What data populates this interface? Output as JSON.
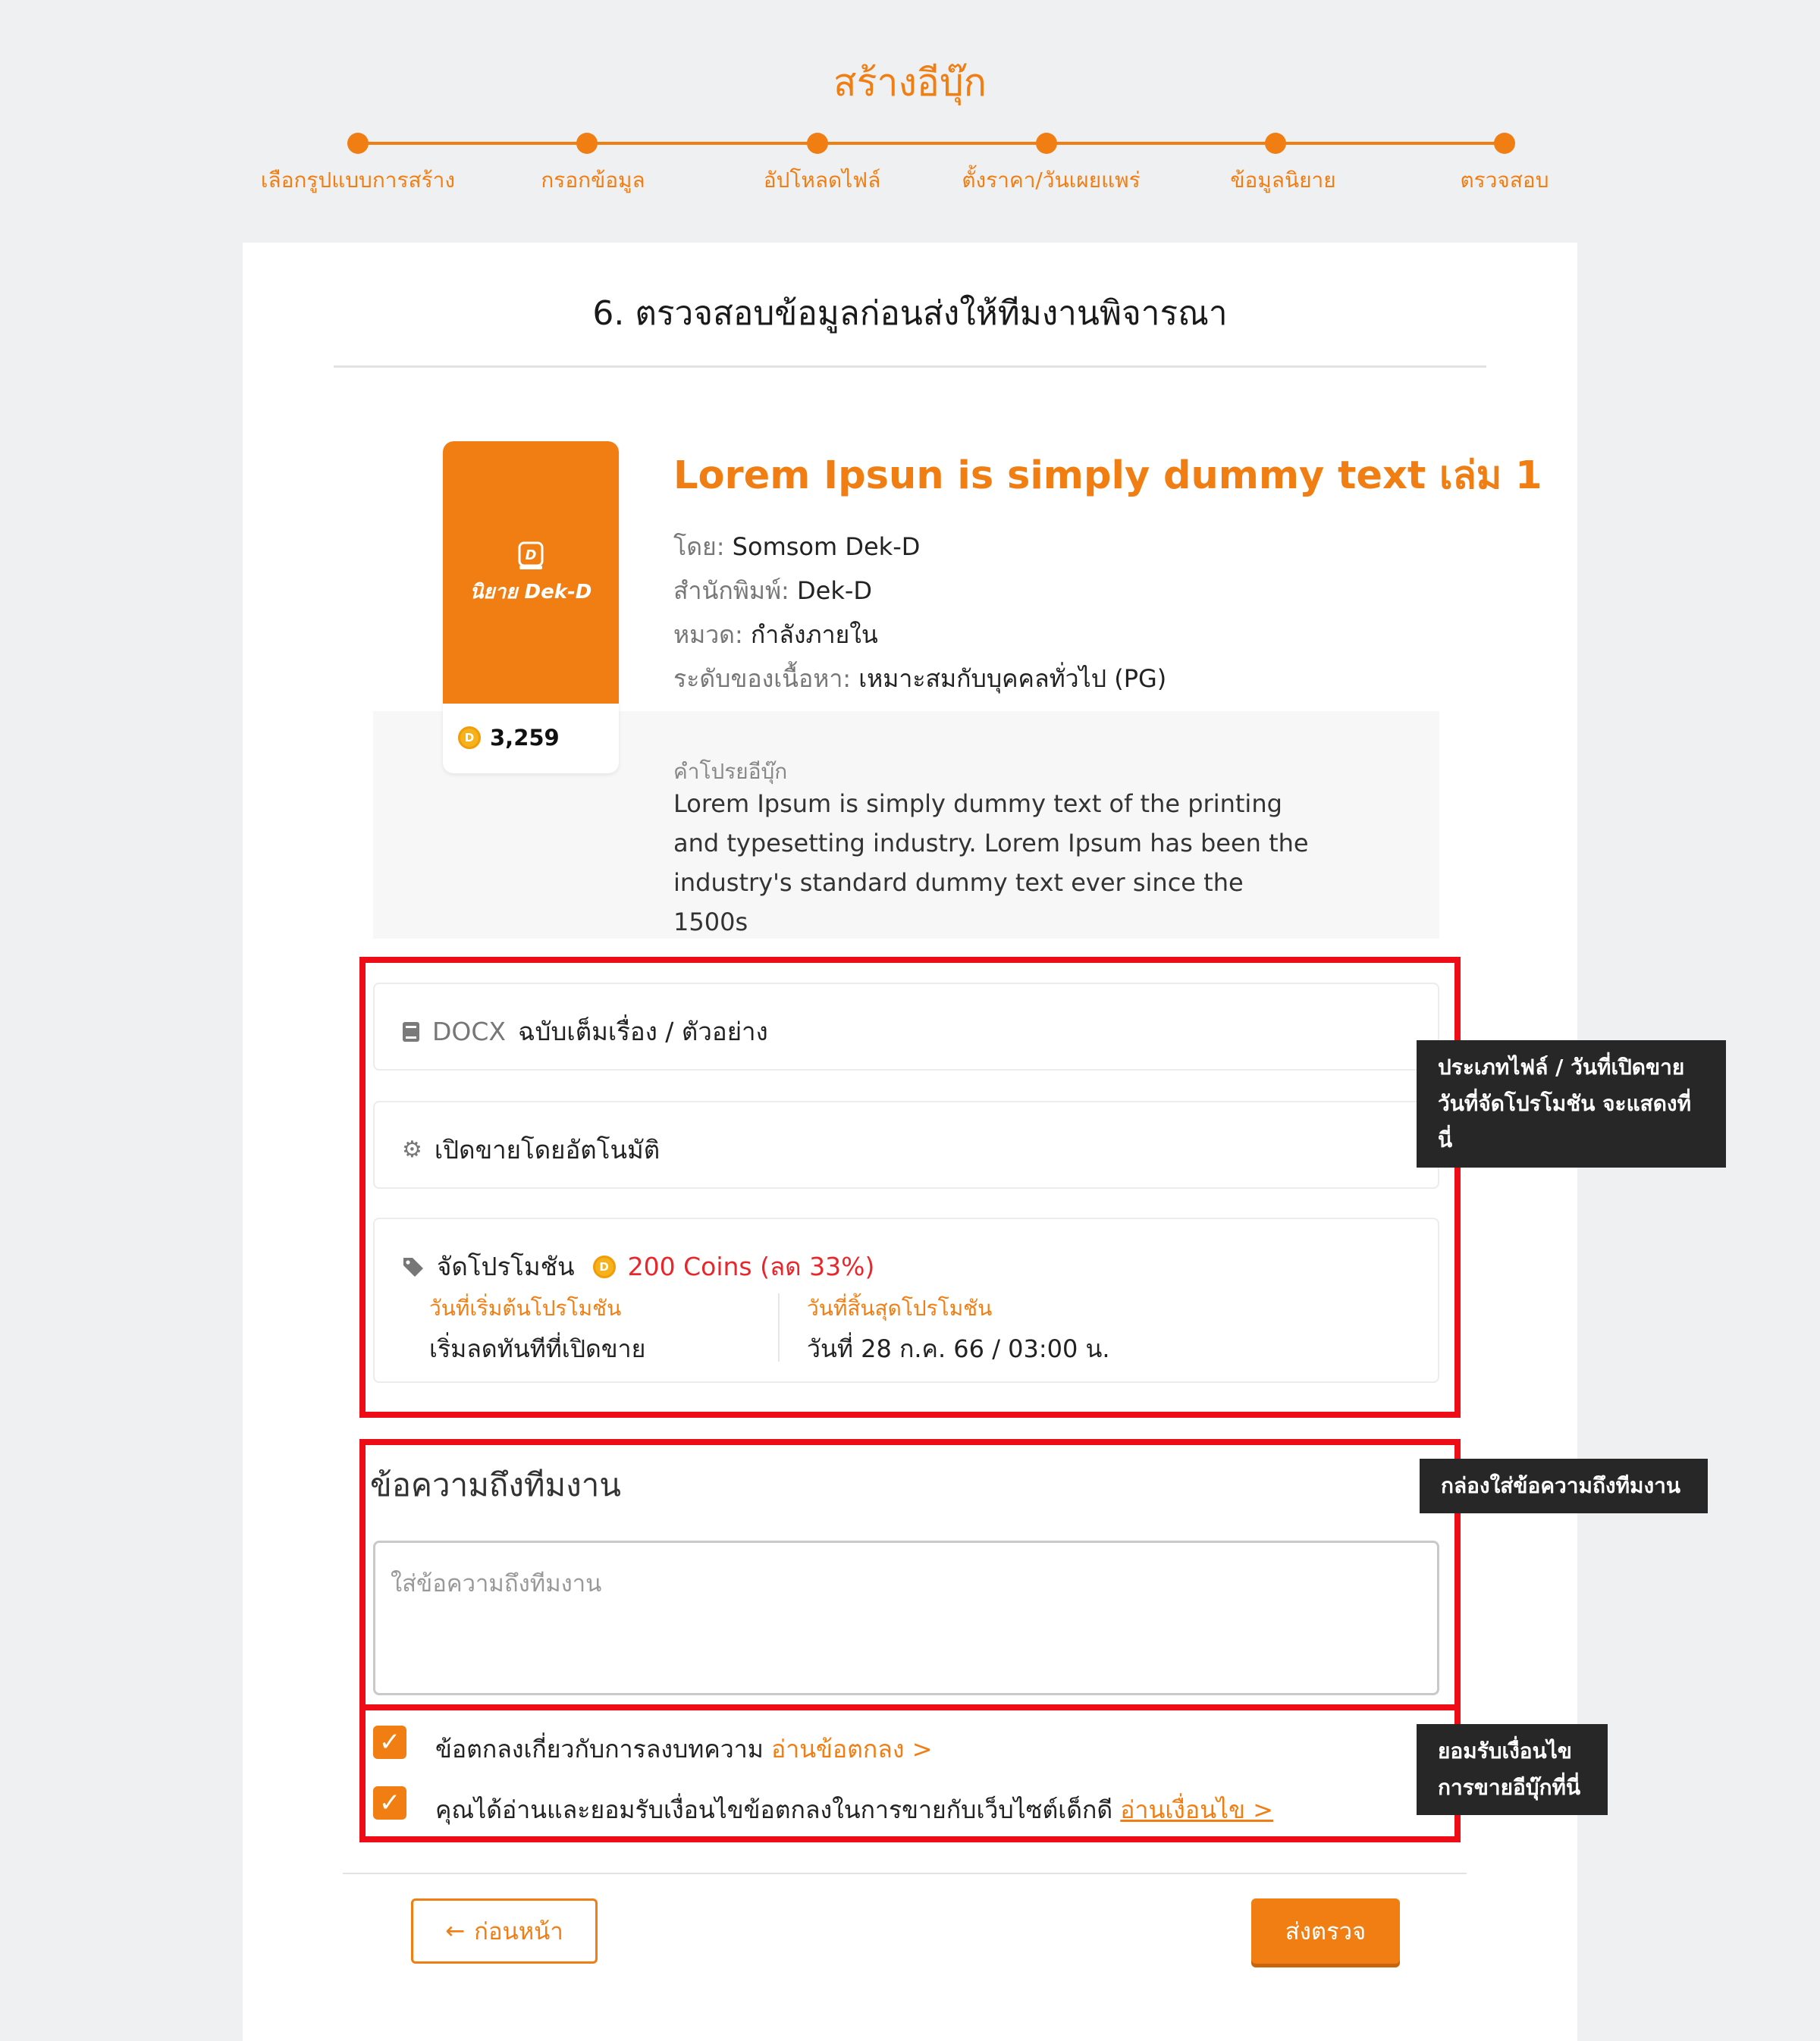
{
  "header": {
    "title": "สร้างอีบุ๊ก",
    "steps": [
      {
        "label": "เลือกรูปแบบการสร้าง"
      },
      {
        "label": "กรอกข้อมูล"
      },
      {
        "label": "อัปโหลดไฟล์"
      },
      {
        "label": "ตั้งราคา/วันเผยแพร่"
      },
      {
        "label": "ข้อมูลนิยาย"
      },
      {
        "label": "ตรวจสอบ"
      }
    ]
  },
  "card": {
    "title": "6. ตรวจสอบข้อมูลก่อนส่งให้ทีมงานพิจารณา"
  },
  "book": {
    "cover_logo": "นิยาย Dek-D",
    "coin_symbol": "D",
    "price": "3,259",
    "title": "Lorem Ipsun is simply dummy text เล่ม 1",
    "meta": [
      {
        "key": "โดย:",
        "value": "Somsom Dek-D"
      },
      {
        "key": "สำนักพิมพ์:",
        "value": "Dek-D"
      },
      {
        "key": "หมวด:",
        "value": "กำลังภายใน"
      },
      {
        "key": "ระดับของเนื้อหา:",
        "value": "เหมาะสมกับบุคคลทั่วไป (PG)"
      }
    ],
    "description_label": "คำโปรยอีบุ๊ก",
    "description": "Lorem Ipsum is simply dummy text of the printing and typesetting industry. Lorem Ipsum has been the industry's standard dummy text ever since the 1500s"
  },
  "info": {
    "file_type": "DOCX",
    "file_version": "ฉบับเต็มเรื่อง / ตัวอย่าง",
    "sale_mode": "เปิดขายโดยอัตโนมัติ",
    "promo": {
      "label": "จัดโปรโมชัน",
      "price": "200 Coins (ลด 33%)",
      "start_label": "วันที่เริ่มต้นโปรโมชัน",
      "start_value": "เริ่มลดทันทีที่เปิดขาย",
      "end_label": "วันที่สิ้นสุดโปรโมชัน",
      "end_value": "วันที่ 28 ก.ค. 66 / 03:00 น."
    }
  },
  "message": {
    "heading": "ข้อความถึงทีมงาน",
    "placeholder": "ใส่ข้อความถึงทีมงาน",
    "value": ""
  },
  "agreements": [
    {
      "text": "ข้อตกลงเกี่ยวกับการลงบทความ",
      "link": "อ่านข้อตกลง >",
      "checked": true
    },
    {
      "text": "คุณได้อ่านและยอมรับเงื่อนไขข้อตกลงในการขายกับเว็บไซต์เด็กดี",
      "link": "อ่านเงื่อนไข >",
      "checked": true
    }
  ],
  "callouts": {
    "info": [
      "ประเภทไฟล์ / วันที่เปิดขาย",
      "วันที่จัดโปรโมชัน จะแสดงที่นี่"
    ],
    "message": [
      "กล่องใส่ข้อความถึงทีมงาน"
    ],
    "terms": [
      "ยอมรับเงื่อนไข",
      "การขายอีบุ๊กที่นี่"
    ]
  },
  "footer": {
    "back_label": "ก่อนหน้า",
    "submit_label": "ส่งตรวจ"
  },
  "colors": {
    "accent": "#f07e13",
    "annotation_red": "#ee0c16",
    "promo_red": "#e8262b",
    "callout_bg": "#272727"
  }
}
